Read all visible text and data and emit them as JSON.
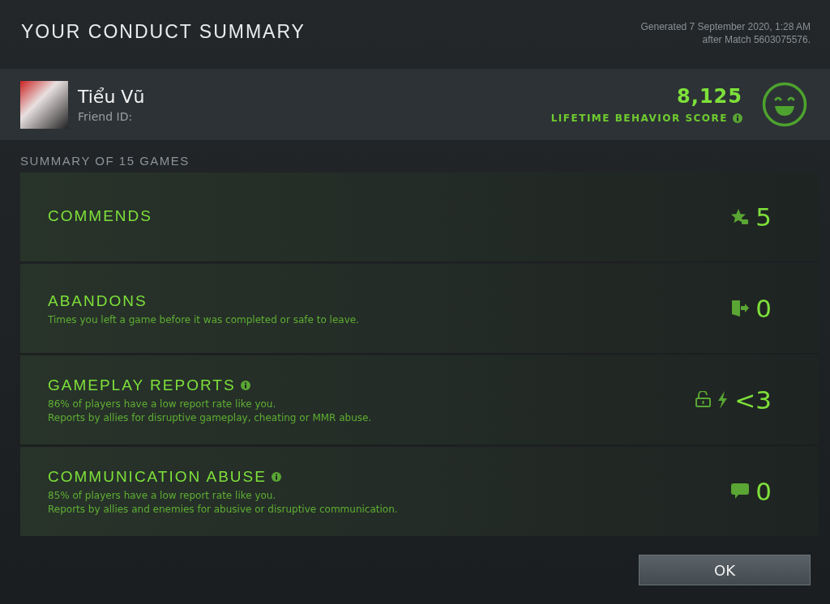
{
  "header": {
    "title": "YOUR CONDUCT SUMMARY",
    "generated": [
      "Generated 7 September 2020, 1:28 AM",
      "after Match 5603075576."
    ]
  },
  "profile": {
    "name": "Tiểu Vũ",
    "friend_id_label": "Friend ID:",
    "score": "8,125",
    "score_label": "LIFETIME BEHAVIOR SCORE"
  },
  "summary_title": "SUMMARY OF 15 GAMES",
  "rows": [
    {
      "kind": "commends",
      "title": "COMMENDS",
      "info": false,
      "lines": [],
      "value": "5"
    },
    {
      "kind": "abandons",
      "title": "ABANDONS",
      "info": false,
      "lines": [
        "Times you left a game before it was completed or safe to leave."
      ],
      "value": "0"
    },
    {
      "kind": "gameplay",
      "title": "GAMEPLAY REPORTS",
      "info": true,
      "lines": [
        "86% of players have a low report rate like you.",
        "Reports by allies for disruptive gameplay, cheating or MMR abuse."
      ],
      "value": "<3"
    },
    {
      "kind": "communication",
      "title": "COMMUNICATION ABUSE",
      "info": true,
      "lines": [
        "85% of players have a low report rate like you.",
        "Reports by allies and enemies for abusive or disruptive communication."
      ],
      "value": "0"
    }
  ],
  "ok_button": "OK"
}
